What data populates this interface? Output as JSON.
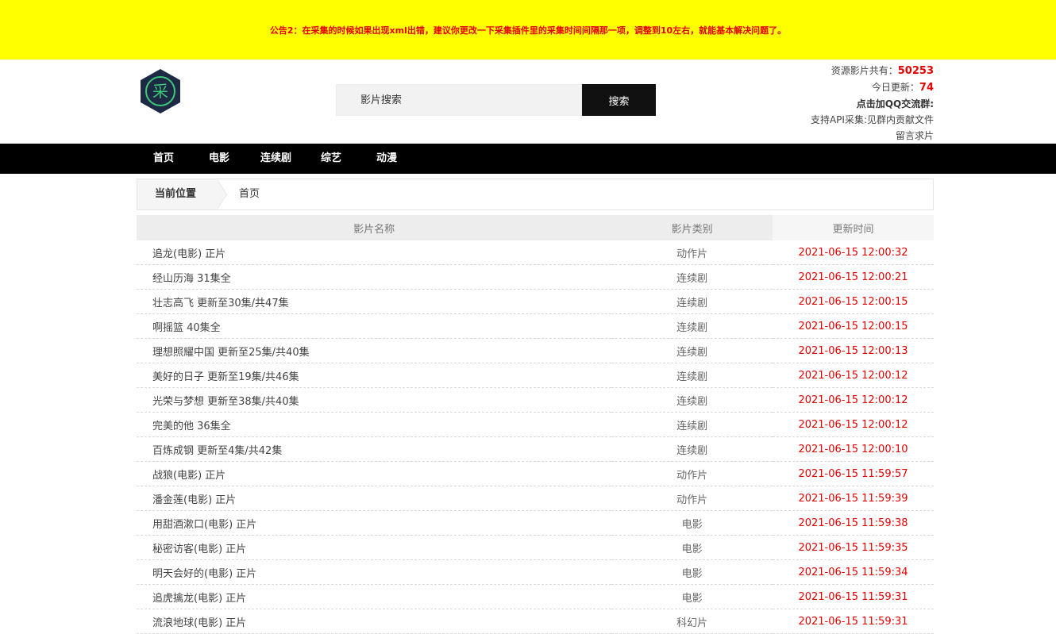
{
  "notice": {
    "text": "公告2：在采集的时候如果出现xml出错，建议你更改一下采集插件里的采集时间间隔那一项，调整到10左右，就能基本解决问题了。"
  },
  "logo": {
    "glyph": "采",
    "colors": {
      "ring": "#1e2a44",
      "glyph": "#3cc878"
    }
  },
  "search": {
    "placeholder": "影片搜索",
    "button": "搜索"
  },
  "stats": {
    "total_label": "资源影片共有：",
    "total_value": "50253",
    "today_label": "今日更新：",
    "today_value": "74",
    "qq": "点击加QQ交流群:",
    "api": "支持API采集:见群内贡献文件",
    "request": "留言求片"
  },
  "nav": {
    "items": [
      "首页",
      "电影",
      "连续剧",
      "综艺",
      "动漫"
    ]
  },
  "breadcrumb": {
    "label": "当前位置",
    "current": "首页"
  },
  "table": {
    "headers": [
      "影片名称",
      "影片类别",
      "更新时间"
    ],
    "rows": [
      [
        "追龙(电影) 正片",
        "动作片",
        "2021-06-15 12:00:32"
      ],
      [
        "经山历海 31集全",
        "连续剧",
        "2021-06-15 12:00:21"
      ],
      [
        "壮志高飞 更新至30集/共47集",
        "连续剧",
        "2021-06-15 12:00:15"
      ],
      [
        "啊摇篮 40集全",
        "连续剧",
        "2021-06-15 12:00:15"
      ],
      [
        "理想照耀中国 更新至25集/共40集",
        "连续剧",
        "2021-06-15 12:00:13"
      ],
      [
        "美好的日子 更新至19集/共46集",
        "连续剧",
        "2021-06-15 12:00:12"
      ],
      [
        "光荣与梦想 更新至38集/共40集",
        "连续剧",
        "2021-06-15 12:00:12"
      ],
      [
        "完美的他 36集全",
        "连续剧",
        "2021-06-15 12:00:12"
      ],
      [
        "百炼成钢 更新至4集/共42集",
        "连续剧",
        "2021-06-15 12:00:10"
      ],
      [
        "战狼(电影) 正片",
        "动作片",
        "2021-06-15 11:59:57"
      ],
      [
        "潘金莲(电影) 正片",
        "动作片",
        "2021-06-15 11:59:39"
      ],
      [
        "用甜酒漱口(电影) 正片",
        "电影",
        "2021-06-15 11:59:38"
      ],
      [
        "秘密访客(电影) 正片",
        "电影",
        "2021-06-15 11:59:35"
      ],
      [
        "明天会好的(电影) 正片",
        "电影",
        "2021-06-15 11:59:34"
      ],
      [
        "追虎擒龙(电影) 正片",
        "电影",
        "2021-06-15 11:59:31"
      ],
      [
        "流浪地球(电影) 正片",
        "科幻片",
        "2021-06-15 11:59:31"
      ]
    ]
  }
}
